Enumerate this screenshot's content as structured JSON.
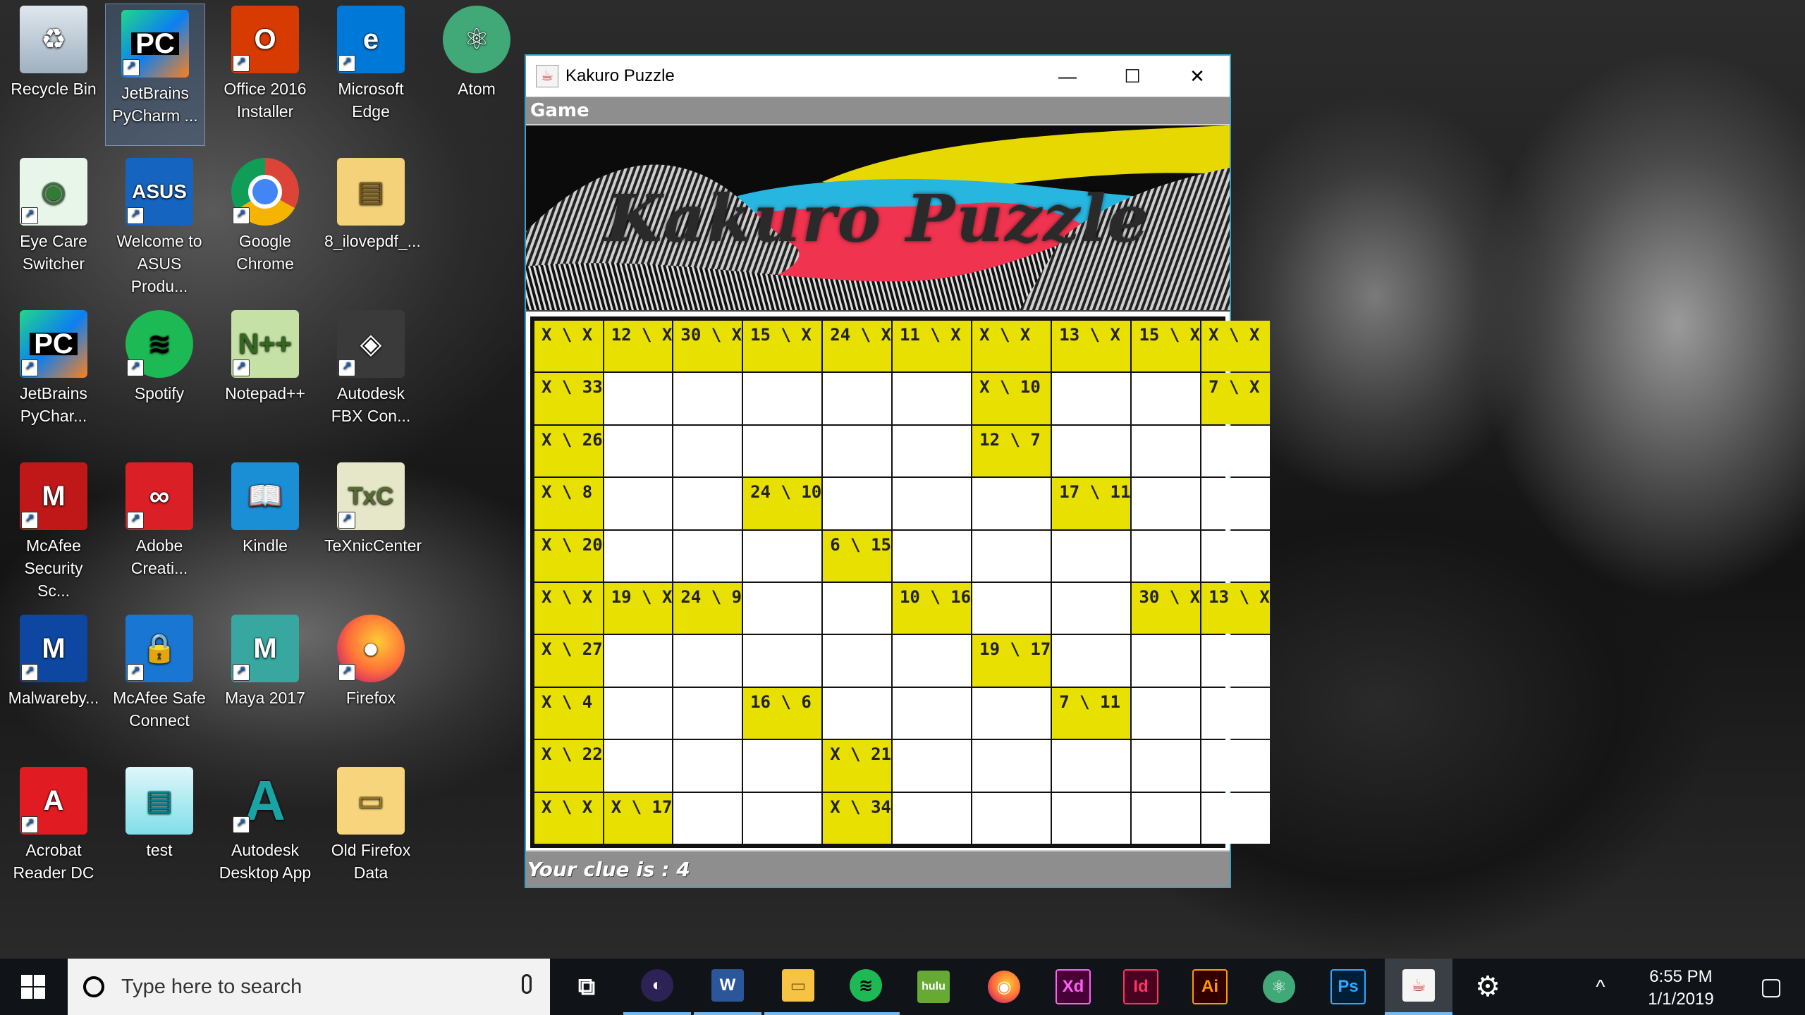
{
  "desktop": {
    "icons": [
      {
        "label": "Recycle Bin",
        "icon": "recycle-bin-icon"
      },
      {
        "label": "JetBrains PyCharm ...",
        "icon": "pycharm-icon"
      },
      {
        "label": "Office 2016 Installer",
        "icon": "office-icon"
      },
      {
        "label": "Microsoft Edge",
        "icon": "edge-icon"
      },
      {
        "label": "Atom",
        "icon": "atom-icon"
      },
      {
        "label": "Eye Care Switcher",
        "icon": "eye-care-icon"
      },
      {
        "label": "Welcome to ASUS Produ...",
        "icon": "asus-icon"
      },
      {
        "label": "Google Chrome",
        "icon": "chrome-icon"
      },
      {
        "label": "8_ilovepdf_...",
        "icon": "zip-folder-icon"
      },
      {
        "label": "JetBrains PyChar...",
        "icon": "pycharm-icon"
      },
      {
        "label": "Spotify",
        "icon": "spotify-icon"
      },
      {
        "label": "Notepad++",
        "icon": "notepadpp-icon"
      },
      {
        "label": "Autodesk FBX Con...",
        "icon": "fbx-icon"
      },
      {
        "label": "McAfee Security Sc...",
        "icon": "mcafee-icon"
      },
      {
        "label": "Adobe Creati...",
        "icon": "creative-cloud-icon"
      },
      {
        "label": "Kindle",
        "icon": "kindle-icon"
      },
      {
        "label": "TeXnicCenter",
        "icon": "texniccenter-icon"
      },
      {
        "label": "Malwareby...",
        "icon": "malwarebytes-icon"
      },
      {
        "label": "McAfee Safe Connect",
        "icon": "mcafee-safe-connect-icon"
      },
      {
        "label": "Maya 2017",
        "icon": "maya-icon"
      },
      {
        "label": "Firefox",
        "icon": "firefox-icon"
      },
      {
        "label": "Acrobat Reader DC",
        "icon": "acrobat-icon"
      },
      {
        "label": "test",
        "icon": "notepad-file-icon"
      },
      {
        "label": "Autodesk Desktop App",
        "icon": "autodesk-icon"
      },
      {
        "label": "Old Firefox Data",
        "icon": "folder-icon"
      }
    ]
  },
  "window": {
    "title": "Kakuro Puzzle",
    "menu": "Game",
    "banner_title": "Kakuro Puzzle",
    "status": "Your clue is :  4",
    "controls": {
      "minimize": "—",
      "maximize": "☐",
      "close": "✕"
    }
  },
  "board": {
    "rows": [
      [
        "X \\ X",
        "12 \\ X",
        "30 \\ X",
        "15 \\ X",
        "24 \\ X",
        "11 \\ X",
        "X \\ X",
        "13 \\ X",
        "15 \\ X",
        "X \\ X"
      ],
      [
        "X \\ 33",
        "",
        "",
        "",
        "",
        "",
        "X \\ 10",
        "",
        "",
        "7 \\ X"
      ],
      [
        "X \\ 26",
        "",
        "",
        "",
        "",
        "",
        "12 \\ 7",
        "",
        "",
        ""
      ],
      [
        "X \\ 8",
        "",
        "",
        "24 \\ 10",
        "",
        "",
        "",
        "17 \\ 11",
        "",
        ""
      ],
      [
        "X \\ 20",
        "",
        "",
        "",
        "6 \\ 15",
        "",
        "",
        "",
        "",
        ""
      ],
      [
        "X \\ X",
        "19 \\ X",
        "24 \\ 9",
        "",
        "",
        "10 \\ 16",
        "",
        "",
        "30 \\ X",
        "13 \\ X"
      ],
      [
        "X \\ 27",
        "",
        "",
        "",
        "",
        "",
        "19 \\ 17",
        "",
        "",
        ""
      ],
      [
        "X \\ 4",
        "",
        "",
        "16 \\ 6",
        "",
        "",
        "",
        "7 \\ 11",
        "",
        ""
      ],
      [
        "X \\ 22",
        "",
        "",
        "",
        "X \\ 21",
        "",
        "",
        "",
        "",
        ""
      ],
      [
        "X \\ X",
        "X \\ 17",
        "",
        "",
        "X \\ 34",
        "",
        "",
        "",
        "",
        ""
      ]
    ],
    "clue_color": "#e8e000"
  },
  "taskbar": {
    "search_placeholder": "Type here to search",
    "apps": [
      {
        "name": "task-view",
        "label": "⧉"
      },
      {
        "name": "eclipse",
        "label": "◐"
      },
      {
        "name": "word",
        "label": "W"
      },
      {
        "name": "file-explorer",
        "label": "▭"
      },
      {
        "name": "spotify",
        "label": "≋"
      },
      {
        "name": "hulu",
        "label": "hulu"
      },
      {
        "name": "firefox",
        "label": "◉"
      },
      {
        "name": "adobe-xd",
        "label": "Xd"
      },
      {
        "name": "indesign",
        "label": "Id"
      },
      {
        "name": "illustrator",
        "label": "Ai"
      },
      {
        "name": "atom",
        "label": "⚛"
      },
      {
        "name": "photoshop",
        "label": "Ps"
      },
      {
        "name": "java",
        "label": "☕"
      },
      {
        "name": "settings",
        "label": "⚙"
      }
    ],
    "tray_chevron": "^",
    "time": "6:55 PM",
    "date": "1/1/2019",
    "notification": "▢"
  }
}
